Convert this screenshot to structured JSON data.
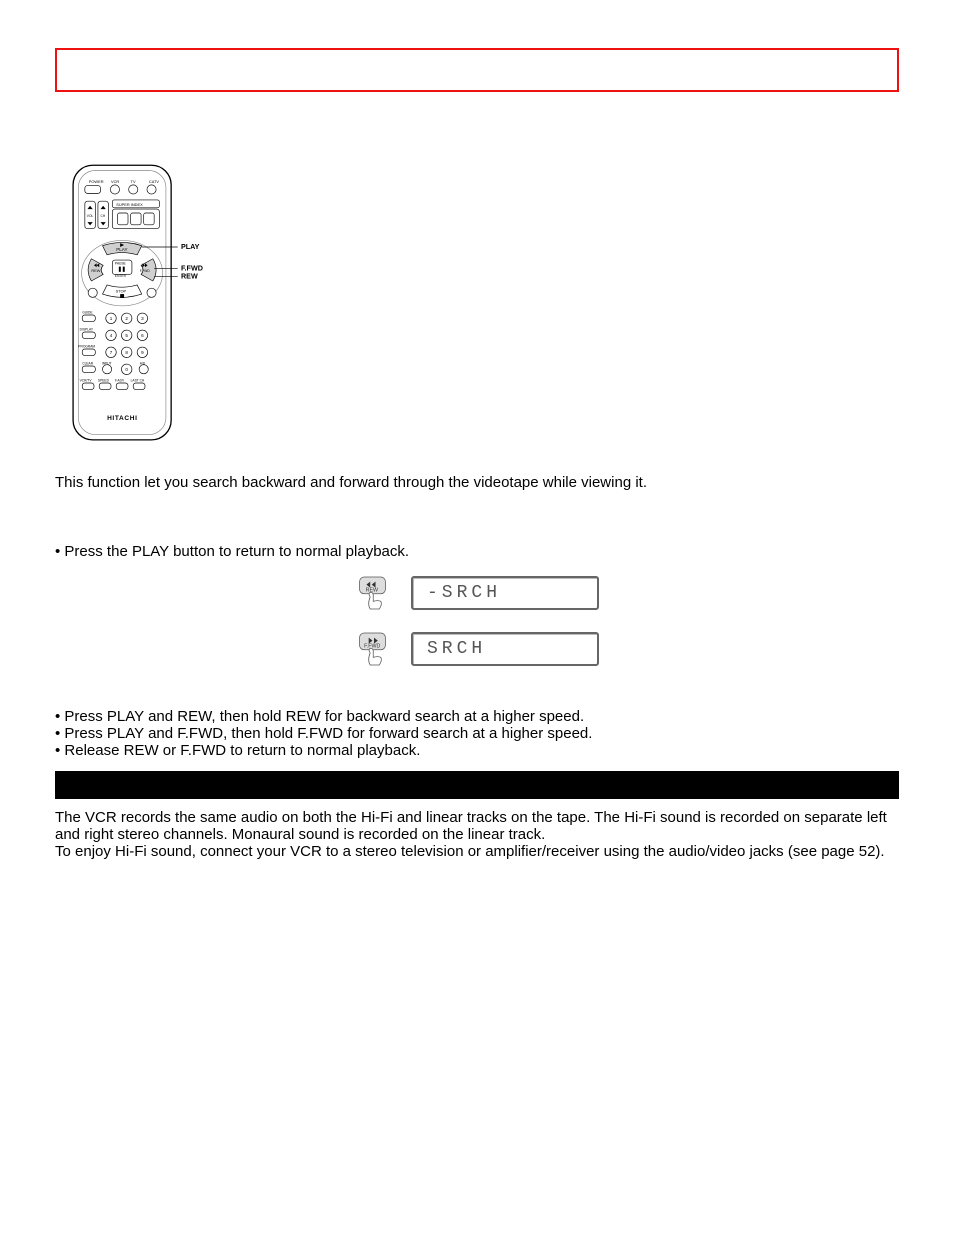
{
  "remote": {
    "brand": "HITACHI",
    "top_labels": [
      "POWER",
      "VCR",
      "TV",
      "CATV"
    ],
    "superindex": "SUPER INDEX",
    "vol": "VOL",
    "ch": "CH",
    "callouts": [
      "PLAY",
      "F.FWD",
      "REW"
    ],
    "transport": {
      "play": "PLAY",
      "pause": "PAUSE",
      "enter": "ENTER",
      "rew": "REW",
      "ffwd": "F.FWD",
      "stop": "STOP"
    },
    "side_labels": [
      "GUIDE",
      "DISPLAY",
      "PROGRAM",
      "CLEAR",
      "INPUT",
      "A/D",
      "VCR/TV",
      "SPEED",
      "F.ADV",
      "LAST CH"
    ]
  },
  "intro": "This function let you search backward and forward through the videotape while viewing it.",
  "step1": "• Press the PLAY button to return to normal playback.",
  "lcd": {
    "rew_btn": "REW",
    "ffwd_btn": "F.FWD",
    "disp_rew": "-SRCH",
    "disp_ffwd": " SRCH"
  },
  "step2": {
    "b1": "• Press PLAY and REW, then hold REW for backward search at a higher speed.",
    "b2": "• Press PLAY and F.FWD, then hold F.FWD for forward search at a higher speed.",
    "b3": "• Release REW or F.FWD to return to normal playback."
  },
  "hifi": {
    "p1": "The VCR records the same audio on both the Hi-Fi and linear tracks on the tape. The Hi-Fi sound is recorded on separate left and right stereo channels. Monaural sound is recorded on the linear track.",
    "p2": "To enjoy Hi-Fi sound, connect your VCR to a stereo television or amplifier/receiver using the audio/video jacks (see page 52)."
  }
}
